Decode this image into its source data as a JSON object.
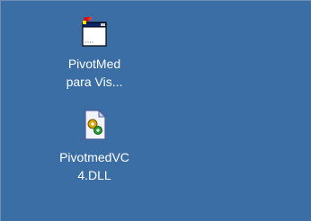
{
  "desktop": {
    "background_color": "#3a6ea5",
    "icons": [
      {
        "icon": "application-window-icon",
        "label_line1": "PivotMed",
        "label_line2": "para Vis..."
      },
      {
        "icon": "dll-file-icon",
        "label_line1": "PivotmedVC",
        "label_line2": "4.DLL"
      }
    ]
  }
}
